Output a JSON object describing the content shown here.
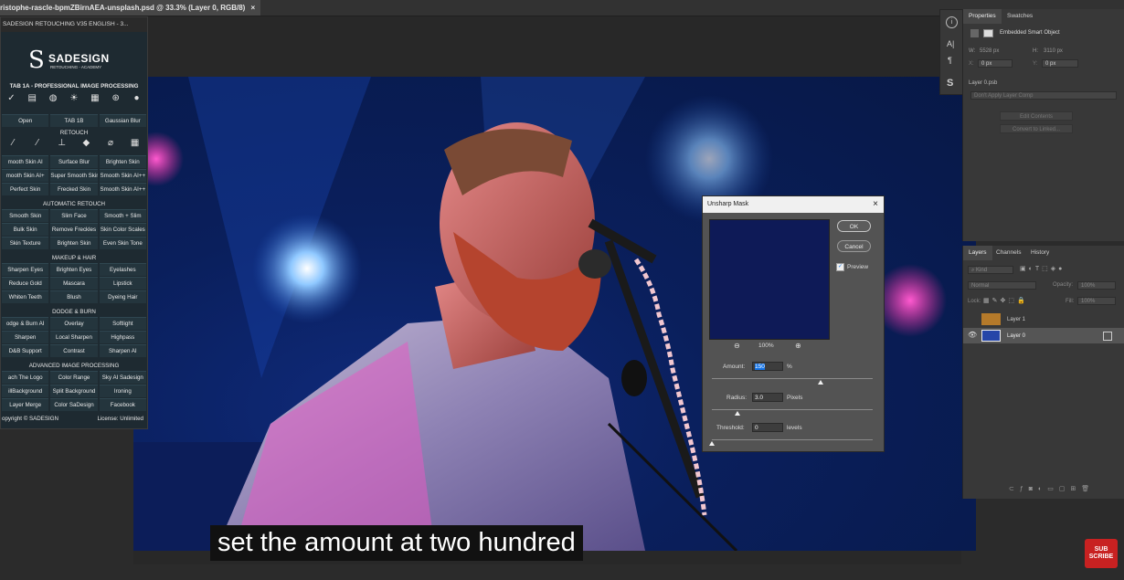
{
  "document": {
    "tab_title": "ristophe-rascle-bpmZBirnAEA-unsplash.psd @ 33.3% (Layer 0, RGB/8)"
  },
  "sadesign": {
    "panel_title": "SADESIGN RETOUCHING V35 ENGLISH - 3...",
    "brand": "SADESIGN",
    "brand_sub": "RETOUCHING - ACADEMY",
    "tab_heading": "TAB 1A - PROFESSIONAL IMAGE PROCESSING",
    "top_buttons": [
      "Open",
      "TAB 1B",
      "Gaussian Blur"
    ],
    "sections": [
      {
        "heading": "RETOUCH",
        "rows": [
          [
            "mooth Skin AI",
            "Surface Blur",
            "Brighten Skin"
          ],
          [
            "mooth Skin AI+",
            "Super Smooth Skin",
            "Smooth Skin AI++"
          ],
          [
            "Perfect Skin",
            "Frecked Skin",
            "Smooth Skin AI++"
          ]
        ]
      },
      {
        "heading": "AUTOMATIC RETOUCH",
        "rows": [
          [
            "Smooth Skin",
            "Slim Face",
            "Smooth + Slim"
          ],
          [
            "Bulk Skin",
            "Remove Freckles",
            "Skin Color Scales"
          ],
          [
            "Skin Texture",
            "Brighten Skin",
            "Even Skin Tone"
          ]
        ]
      },
      {
        "heading": "MAKEUP & HAIR",
        "rows": [
          [
            "Sharpen Eyes",
            "Brighten Eyes",
            "Eyelashes"
          ],
          [
            "Reduce Gold",
            "Mascara",
            "Lipstick"
          ],
          [
            "Whiten Teeth",
            "Blush",
            "Dyeing Hair"
          ]
        ]
      },
      {
        "heading": "DODGE & BURN",
        "rows": [
          [
            "odge & Burn AI",
            "Overlay",
            "Softlight"
          ],
          [
            "Sharpen",
            "Local Sharpen",
            "Highpass"
          ],
          [
            "D&B Support",
            "Contrast",
            "Sharpen AI"
          ]
        ]
      },
      {
        "heading": "ADVANCED IMAGE PROCESSING",
        "rows": [
          [
            "ach The Logo",
            "Color Range",
            "Sky AI Sadesign"
          ],
          [
            "illBackground",
            "Split Background",
            "Ironing"
          ],
          [
            "Layer Merge",
            "Color SaDesign",
            "Facebook"
          ]
        ]
      }
    ],
    "footer_left": "opyright © SADESIGN",
    "footer_right": "License: Unlimited"
  },
  "properties": {
    "tabs": [
      "Properties",
      "Swatches"
    ],
    "object_type": "Embedded Smart Object",
    "w_label": "W:",
    "w_value": "5528 px",
    "h_label": "H:",
    "h_value": "3110 px",
    "x_label": "X:",
    "x_value": "0 px",
    "y_label": "Y:",
    "y_value": "0 px",
    "file": "Layer 0.psb",
    "layer_comp": "Don't Apply Layer Comp",
    "edit_contents": "Edit Contents",
    "convert_linked": "Convert to Linked..."
  },
  "layers": {
    "tabs": [
      "Layers",
      "Channels",
      "History"
    ],
    "kind": "Kind",
    "blend": "Normal",
    "opacity_label": "Opacity:",
    "opacity_value": "100%",
    "lock_label": "Lock:",
    "fill_label": "Fill:",
    "fill_value": "100%",
    "items": [
      {
        "name": "Layer 1"
      },
      {
        "name": "Layer 0"
      }
    ]
  },
  "dialog": {
    "title": "Unsharp Mask",
    "ok": "OK",
    "cancel": "Cancel",
    "preview_label": "Preview",
    "zoom": "100%",
    "amount_label": "Amount:",
    "amount_value": "150",
    "amount_unit": "%",
    "radius_label": "Radius:",
    "radius_value": "3.0",
    "radius_unit": "Pixels",
    "threshold_label": "Threshold:",
    "threshold_value": "0",
    "threshold_unit": "levels"
  },
  "caption": "set the amount at two hundred",
  "subscribe": "SUB SCRIBE",
  "colors": {
    "accent": "#1473e6",
    "stage_blue": "#0a1f5c",
    "subscribe_red": "#c82121"
  }
}
